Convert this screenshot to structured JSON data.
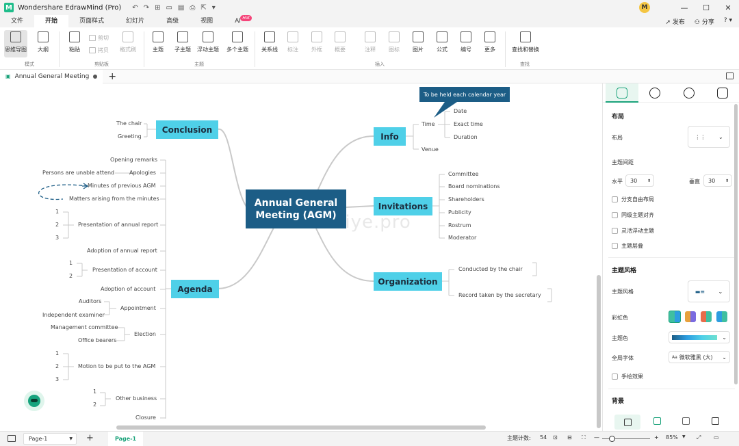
{
  "app": {
    "title": "Wondershare EdrawMind (Pro)",
    "avatar_letter": "M"
  },
  "quick_access": [
    "↶",
    "↷",
    "⊞",
    "▭",
    "▤",
    "⎙",
    "⇱",
    "▾"
  ],
  "window_controls": [
    "—",
    "☐",
    "✕"
  ],
  "menu": {
    "tabs": [
      "文件",
      "开始",
      "页面样式",
      "幻灯片",
      "高级",
      "视图",
      "AI"
    ],
    "active": "开始",
    "hot_badge": "Hot",
    "publish": "发布",
    "share": "分享",
    "help": "?"
  },
  "ribbon": {
    "mode": {
      "mindmap": "思维导图",
      "outline": "大纲",
      "label": "模式"
    },
    "clipboard": {
      "paste": "粘贴",
      "cut": "剪切",
      "copy": "拷贝",
      "format_painter": "格式刷",
      "label": "剪贴板"
    },
    "topic": {
      "topic": "主题",
      "subtopic": "子主题",
      "floating": "浮动主题",
      "multiple": "多个主题",
      "label": "主题"
    },
    "insert": {
      "relation": "关系线",
      "callout": "标注",
      "boundary": "外框",
      "summary": "概要",
      "note": "注释",
      "icon": "图标",
      "image": "图片",
      "formula": "公式",
      "numbering": "编号",
      "more": "更多",
      "label": "插入"
    },
    "find": {
      "find_replace": "查找和替换",
      "label": "查找"
    }
  },
  "doc_tab": {
    "name": "Annual General Meeting"
  },
  "mindmap": {
    "central": "Annual General Meeting (AGM)",
    "watermark": "baiye.pro",
    "callout": "To be held each calendar year",
    "conclusion": {
      "label": "Conclusion",
      "children": [
        "The chair",
        "Greeting"
      ]
    },
    "agenda": {
      "label": "Agenda",
      "children": [
        "Opening remarks",
        "Apologies",
        "Minutes of previous AGM",
        "Matters arising from the minutes",
        "Presentation of annual report",
        "Adoption of annual report",
        "Presentation of account",
        "Adoption of account",
        "Appointment",
        "Election",
        "Motion to be put to the AGM",
        "Other business",
        "Closure"
      ],
      "apologies_child": "Persons are unable attend",
      "annual_report_items": [
        "1",
        "2",
        "3"
      ],
      "account_items": [
        "1",
        "2"
      ],
      "appointment_children": [
        "Auditors",
        "Independent examiner"
      ],
      "election_children": [
        "Management committee",
        "Office bearers"
      ],
      "motion_items": [
        "1",
        "2",
        "3"
      ],
      "other_items": [
        "1",
        "2"
      ]
    },
    "info": {
      "label": "Info",
      "time": "Time",
      "venue": "Venue",
      "time_children": [
        "Date",
        "Exact time",
        "Duration"
      ]
    },
    "invitations": {
      "label": "Invitations",
      "children": [
        "Committee",
        "Board nominations",
        "Shareholders",
        "Publicity",
        "Rostrum",
        "Moderator"
      ]
    },
    "organization": {
      "label": "Organization",
      "children": [
        "Conducted by the chair",
        "Record taken by the secretary"
      ]
    }
  },
  "panel": {
    "layout_heading": "布局",
    "layout_label": "布局",
    "spacing_heading": "主题间距",
    "horizontal_label": "水平",
    "horizontal_value": "30",
    "vertical_label": "垂直",
    "vertical_value": "30",
    "checks": [
      "分支自由布局",
      "同级主题对齐",
      "灵活浮动主题",
      "主题层叠"
    ],
    "style_heading": "主题风格",
    "style_label": "主题风格",
    "rainbow_label": "彩虹色",
    "color_label": "主题色",
    "font_label": "全局字体",
    "font_value": "微软雅黑 (大)",
    "hand_drawn": "手绘效果",
    "background_heading": "背景"
  },
  "status": {
    "page_select": "Page-1",
    "active_page": "Page-1",
    "topic_count_label": "主题计数:",
    "topic_count": "54",
    "zoom": "85%"
  },
  "colors": {
    "accent": "#1aa27a",
    "central": "#1c5d86",
    "main_topic": "#4fd0e8",
    "link": "#c9c9c9"
  }
}
